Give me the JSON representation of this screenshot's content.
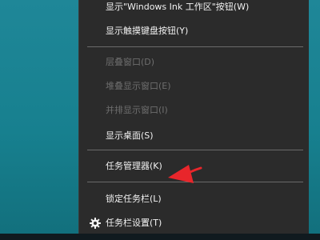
{
  "menu": {
    "items": [
      {
        "label": "显示\"Windows Ink 工作区\"按钮(W)",
        "enabled": true
      },
      {
        "label": "显示触摸键盘按钮(Y)",
        "enabled": true
      },
      {
        "label": "层叠窗口(D)",
        "enabled": false
      },
      {
        "label": "堆叠显示窗口(E)",
        "enabled": false
      },
      {
        "label": "并排显示窗口(I)",
        "enabled": false
      },
      {
        "label": "显示桌面(S)",
        "enabled": true
      },
      {
        "label": "任务管理器(K)",
        "enabled": true
      },
      {
        "label": "锁定任务栏(L)",
        "enabled": true
      },
      {
        "label": "任务栏设置(T)",
        "enabled": true,
        "icon": "gear-icon"
      }
    ]
  },
  "colors": {
    "menu_bg": "#2b2b2b",
    "text": "#f2f2f2",
    "disabled_text": "#6e6e6e",
    "arrow": "#e8262b",
    "desktop": "#1a8494"
  }
}
